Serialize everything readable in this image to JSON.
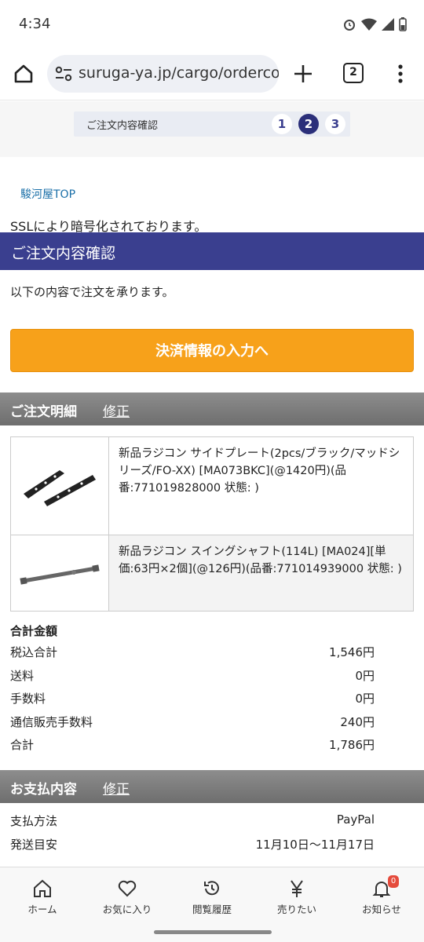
{
  "status": {
    "time": "4:34"
  },
  "browser": {
    "url": "suruga-ya.jp/cargo/orderco",
    "tab_count": "2"
  },
  "steps": {
    "label": "ご注文内容確認",
    "step1": "1",
    "step2": "2",
    "step3": "3"
  },
  "page": {
    "top_link": "駿河屋TOP",
    "ssl_notice": "SSLにより暗号化されております。",
    "title": "ご注文内容確認",
    "intro": "以下の内容で注文を承ります。",
    "cta": "決済情報の入力へ"
  },
  "order": {
    "heading": "ご注文明細",
    "edit": "修正",
    "items": [
      {
        "description": "新品ラジコン サイドプレート(2pcs/ブラック/マッドシリーズ/FO-XX) [MA073BKC](@1420円)(品番:771019828000 状態: )"
      },
      {
        "description": "新品ラジコン スイングシャフト(114L) [MA024][単価:63円×2個](@126円)(品番:771014939000 状態: )"
      }
    ]
  },
  "totals": {
    "heading": "合計金額",
    "rows": [
      {
        "label": "税込合計",
        "value": "1,546円"
      },
      {
        "label": "送料",
        "value": "0円"
      },
      {
        "label": "手数料",
        "value": "0円"
      },
      {
        "label": "通信販売手数料",
        "value": "240円"
      },
      {
        "label": "合計",
        "value": "1,786円"
      }
    ]
  },
  "payment": {
    "heading": "お支払内容",
    "edit": "修正",
    "rows": [
      {
        "label": "支払方法",
        "value": "PayPal"
      },
      {
        "label": "発送目安",
        "value": "11月10日〜11月17日"
      }
    ]
  },
  "nav": {
    "home": "ホーム",
    "favorites": "お気に入り",
    "history": "閲覧履歴",
    "sell": "売りたい",
    "notices": "お知らせ",
    "notice_count": "0"
  },
  "colors": {
    "title_bar": "#3a3f8f",
    "cta": "#f7a11a",
    "section_bar": "#7a7a7a"
  }
}
